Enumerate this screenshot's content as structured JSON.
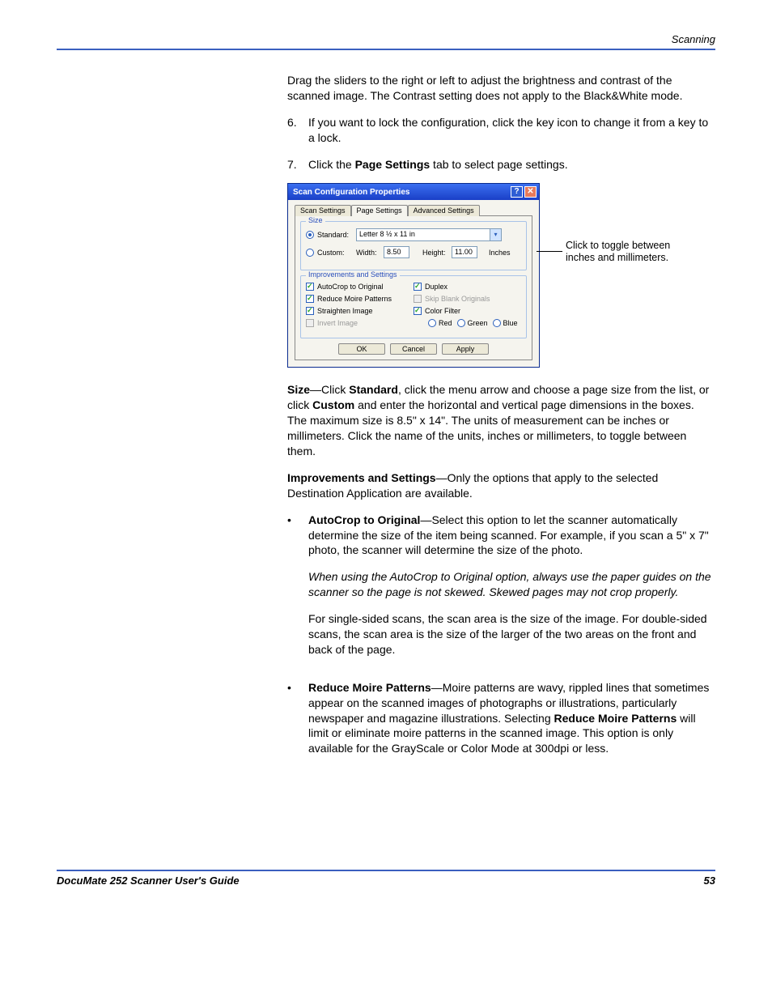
{
  "header": {
    "section": "Scanning"
  },
  "intro_para": "Drag the sliders to the right or left to adjust the brightness and contrast of the scanned image. The Contrast setting does not apply to the Black&White mode.",
  "steps": {
    "six": {
      "num": "6.",
      "text": "If you want to lock the configuration, click the key icon to change it from a key to a lock."
    },
    "seven": {
      "num": "7.",
      "prefix": "Click the ",
      "bold": "Page Settings",
      "suffix": " tab to select page settings."
    }
  },
  "dialog": {
    "title": "Scan Configuration Properties",
    "help_glyph": "?",
    "close_glyph": "✕",
    "tabs": {
      "scan": "Scan Settings",
      "page": "Page Settings",
      "adv": "Advanced Settings"
    },
    "size": {
      "group_title": "Size",
      "standard_label": "Standard:",
      "standard_value": "Letter 8 ½ x 11 in",
      "custom_label": "Custom:",
      "width_label": "Width:",
      "width_value": "8.50",
      "height_label": "Height:",
      "height_value": "11.00",
      "units": "Inches"
    },
    "improvements": {
      "group_title": "Improvements and Settings",
      "autocrop": "AutoCrop to Original",
      "reduce": "Reduce Moire Patterns",
      "straighten": "Straighten Image",
      "invert": "Invert Image",
      "duplex": "Duplex",
      "skip": "Skip Blank Originals",
      "colorfilter": "Color Filter",
      "red": "Red",
      "green": "Green",
      "blue": "Blue"
    },
    "buttons": {
      "ok": "OK",
      "cancel": "Cancel",
      "apply": "Apply"
    }
  },
  "callout": "Click to toggle between inches and millimeters.",
  "size_para": {
    "b1": "Size",
    "t1": "—Click ",
    "b2": "Standard",
    "t2": ", click the menu arrow and choose a page size from the list, or click ",
    "b3": "Custom",
    "t3": " and enter the horizontal and vertical page dimensions in the boxes. The maximum size is 8.5\" x 14\". The units of measurement can be inches or millimeters. Click the name of the units, inches or millimeters, to toggle between them."
  },
  "improve_para": {
    "b1": "Improvements and Settings",
    "t1": "—Only the options that apply to the selected Destination Application are available."
  },
  "bullets": {
    "autocrop": {
      "b1": "AutoCrop to Original",
      "t1": "—Select this option to let the scanner automatically determine the size of the item being scanned. For example, if you scan a 5\" x 7\" photo, the scanner will determine the size of the photo.",
      "note": "When using the AutoCrop to Original option, always use the paper guides on the scanner so the page is not skewed. Skewed pages may not crop properly.",
      "t2": "For single-sided scans, the scan area is the size of the image. For double-sided scans, the scan area is the size of the larger of the two areas on the front and back of the page."
    },
    "reduce": {
      "b1": "Reduce Moire Patterns",
      "t1": "—Moire patterns are wavy, rippled lines that sometimes appear on the scanned images of photographs or illustrations, particularly newspaper and magazine illustrations. Selecting ",
      "b2": "Reduce Moire Patterns",
      "t2": " will limit or eliminate moire patterns in the scanned image. This option is only available for the GrayScale or Color Mode at 300dpi or less."
    }
  },
  "footer": {
    "left": "DocuMate 252 Scanner User's Guide",
    "right": "53"
  }
}
